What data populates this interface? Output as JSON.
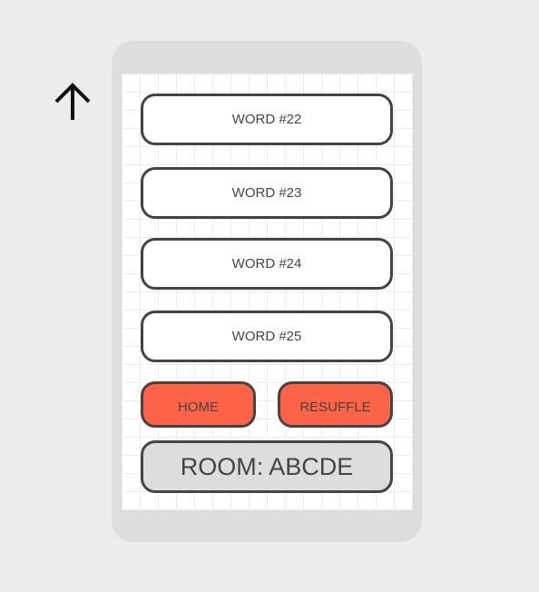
{
  "nav": {
    "back_icon": "arrow-up-icon"
  },
  "words": [
    {
      "label": "WORD #22"
    },
    {
      "label": "WORD #23"
    },
    {
      "label": "WORD #24"
    },
    {
      "label": "WORD #25"
    }
  ],
  "actions": {
    "home_label": "HOME",
    "reshuffle_label": "RESUFFLE"
  },
  "room": {
    "label": "ROOM: ABCDE"
  },
  "colors": {
    "background": "#ececec",
    "device_frame": "#dddddd",
    "screen": "#ffffff",
    "grid_line": "#ececec",
    "button_border": "#444444",
    "button_text": "#444444",
    "accent": "#ff6347",
    "room_fill": "#dddddd"
  }
}
